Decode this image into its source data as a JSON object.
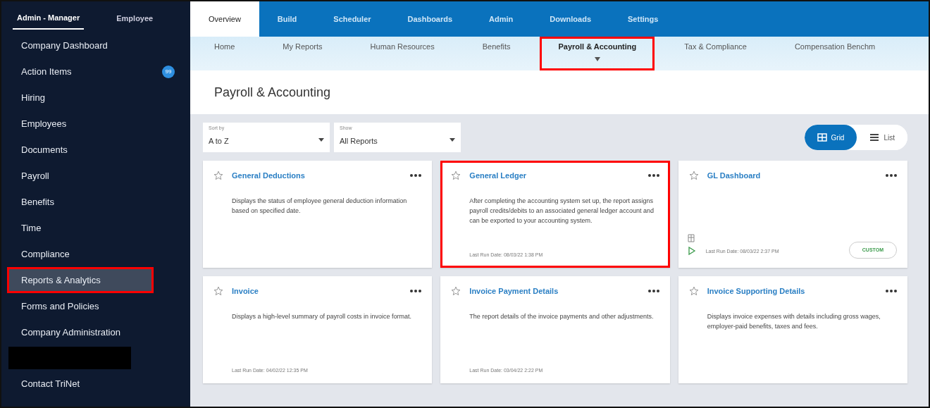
{
  "sidebar": {
    "roles": [
      {
        "label": "Admin - Manager",
        "selected": true
      },
      {
        "label": "Employee",
        "selected": false
      }
    ],
    "items": [
      {
        "kind": "link",
        "label": "Company Dashboard",
        "selected": false,
        "highlighted": false
      },
      {
        "kind": "link",
        "label": "Action Items",
        "selected": false,
        "highlighted": false,
        "badge": "99"
      },
      {
        "kind": "link",
        "label": "Hiring",
        "selected": false,
        "highlighted": false
      },
      {
        "kind": "link",
        "label": "Employees",
        "selected": false,
        "highlighted": false
      },
      {
        "kind": "link",
        "label": "Documents",
        "selected": false,
        "highlighted": false
      },
      {
        "kind": "link",
        "label": "Payroll",
        "selected": false,
        "highlighted": false
      },
      {
        "kind": "link",
        "label": "Benefits",
        "selected": false,
        "highlighted": false
      },
      {
        "kind": "link",
        "label": "Time",
        "selected": false,
        "highlighted": false
      },
      {
        "kind": "link",
        "label": "Compliance",
        "selected": false,
        "highlighted": false
      },
      {
        "kind": "link",
        "label": "Reports & Analytics",
        "selected": true,
        "highlighted": true
      },
      {
        "kind": "link",
        "label": "Forms and Policies",
        "selected": false,
        "highlighted": false
      },
      {
        "kind": "link",
        "label": "Company Administration",
        "selected": false,
        "highlighted": false
      },
      {
        "kind": "redacted"
      },
      {
        "kind": "link",
        "label": "Contact TriNet",
        "selected": false,
        "highlighted": false
      }
    ]
  },
  "tabs": [
    {
      "label": "Overview",
      "selected": true
    },
    {
      "label": "Build",
      "selected": false
    },
    {
      "label": "Scheduler",
      "selected": false
    },
    {
      "label": "Dashboards",
      "selected": false
    },
    {
      "label": "Admin",
      "selected": false
    },
    {
      "label": "Downloads",
      "selected": false
    },
    {
      "label": "Settings",
      "selected": false
    }
  ],
  "subtabs": [
    {
      "label": "Home",
      "selected": false,
      "highlighted": false
    },
    {
      "label": "My Reports",
      "selected": false,
      "highlighted": false
    },
    {
      "label": "Human Resources",
      "selected": false,
      "highlighted": false
    },
    {
      "label": "Benefits",
      "selected": false,
      "highlighted": false
    },
    {
      "label": "Payroll & Accounting",
      "selected": true,
      "highlighted": true
    },
    {
      "label": "Tax & Compliance",
      "selected": false,
      "highlighted": false
    },
    {
      "label": "Compensation Benchm",
      "selected": false,
      "highlighted": false
    }
  ],
  "page_title": "Payroll & Accounting",
  "filters": [
    {
      "label": "Sort by",
      "value": "A to Z"
    },
    {
      "label": "Show",
      "value": "All Reports"
    }
  ],
  "view_toggle": [
    {
      "label": "Grid",
      "selected": true
    },
    {
      "label": "List",
      "selected": false
    }
  ],
  "reports": [
    {
      "title": "General Deductions",
      "description": "Displays the status of employee general deduction information based on specified date.",
      "highlighted": false
    },
    {
      "title": "General Ledger",
      "description": "After completing the accounting system set up, the report assigns payroll credits/debits to an associated general ledger account and can be exported to your accounting system.",
      "last_run": "Last Run Date: 08/03/22 1:38 PM",
      "highlighted": true
    },
    {
      "title": "GL Dashboard",
      "last_run": "Last Run Date: 08/03/22 2:37 PM",
      "tag": "CUSTOM",
      "highlighted": false
    },
    {
      "title": "Invoice",
      "description": "Displays a high-level summary of payroll costs in invoice format.",
      "last_run": "Last Run Date: 04/02/22 12:35 PM",
      "highlighted": false
    },
    {
      "title": "Invoice Payment Details",
      "description": "The report details of the invoice payments and other adjustments.",
      "last_run": "Last Run Date: 03/04/22 2:22 PM",
      "highlighted": false
    },
    {
      "title": "Invoice Supporting Details",
      "description": "Displays invoice expenses with details including gross wages, employer-paid benefits, taxes and fees.",
      "highlighted": false
    }
  ]
}
